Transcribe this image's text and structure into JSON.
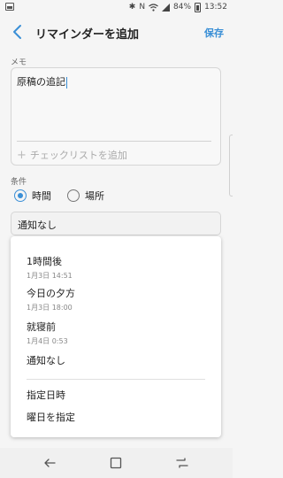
{
  "status_bar": {
    "icons": [
      "image-icon",
      "bluetooth-icon",
      "nfc-icon",
      "wifi-icon",
      "signal-icon",
      "battery-icon"
    ],
    "battery": "84%",
    "time": "13:52"
  },
  "header": {
    "title": "リマインダーを追加",
    "save_label": "保存"
  },
  "memo": {
    "label": "メモ",
    "text": "原稿の追記",
    "checklist_label": "チェックリストを追加"
  },
  "condition": {
    "label": "条件",
    "options": [
      {
        "label": "時間",
        "selected": true
      },
      {
        "label": "場所",
        "selected": false
      }
    ]
  },
  "notification": {
    "value": "通知なし"
  },
  "dropdown": {
    "items": [
      {
        "label": "1時間後",
        "sub": "1月3日 14:51"
      },
      {
        "label": "今日の夕方",
        "sub": "1月3日 18:00"
      },
      {
        "label": "就寝前",
        "sub": "1月4日 0:53"
      },
      {
        "label": "通知なし"
      },
      {
        "label": "指定日時"
      },
      {
        "label": "曜日を指定"
      }
    ]
  },
  "colors": {
    "accent": "#3a8fd6",
    "background": "#f5f5f5"
  }
}
